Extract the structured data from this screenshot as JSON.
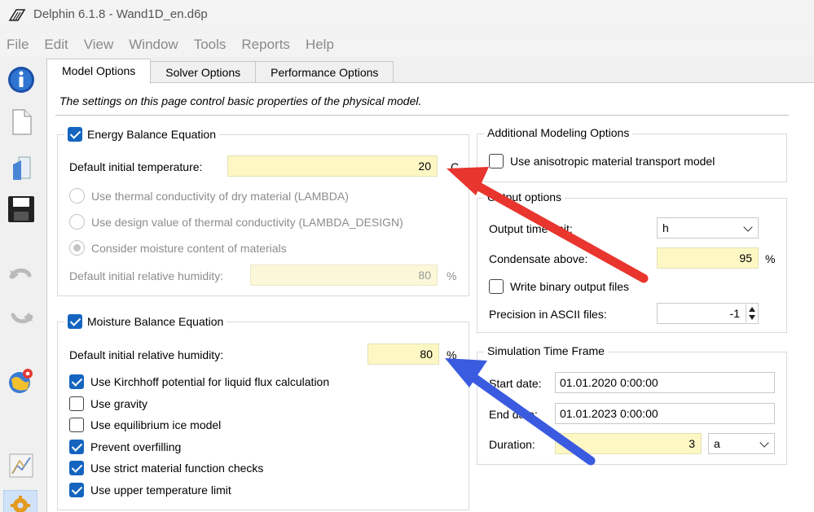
{
  "window": {
    "title": "Delphin 6.1.8 - Wand1D_en.d6p"
  },
  "menu": [
    "File",
    "Edit",
    "View",
    "Window",
    "Tools",
    "Reports",
    "Help"
  ],
  "toolbar": [
    {
      "icon": "info-icon"
    },
    {
      "icon": "new-file-icon"
    },
    {
      "icon": "open-file-icon"
    },
    {
      "icon": "save-icon"
    },
    {
      "icon": "undo-icon"
    },
    {
      "icon": "redo-icon"
    },
    {
      "icon": "globe-location-icon"
    },
    {
      "icon": "chart-icon"
    },
    {
      "icon": "settings-gear-icon"
    }
  ],
  "tabs": [
    "Model Options",
    "Solver Options",
    "Performance Options"
  ],
  "active_tab": "Model Options",
  "intro": "The settings on this page control basic properties of the physical model.",
  "energy": {
    "title": "Energy Balance Equation",
    "checked": true,
    "temp_label": "Default initial temperature:",
    "temp_value": "20",
    "temp_unit": "C",
    "radio1": "Use thermal conductivity of dry material (LAMBDA)",
    "radio2": "Use design value of thermal conductivity (LAMBDA_DESIGN)",
    "radio3": "Consider moisture content of materials",
    "rh_label": "Default initial relative humidity:",
    "rh_value": "80",
    "rh_unit": "%"
  },
  "moisture": {
    "title": "Moisture Balance Equation",
    "checked": true,
    "rh_label": "Default initial relative humidity:",
    "rh_value": "80",
    "rh_unit": "%",
    "options": [
      {
        "label": "Use Kirchhoff potential for liquid flux calculation",
        "checked": true
      },
      {
        "label": "Use gravity",
        "checked": false
      },
      {
        "label": "Use equilibrium ice model",
        "checked": false
      },
      {
        "label": "Prevent overfilling",
        "checked": true
      },
      {
        "label": "Use strict material function checks",
        "checked": true
      },
      {
        "label": "Use upper temperature limit",
        "checked": true
      }
    ]
  },
  "additional": {
    "title": "Additional Modeling Options",
    "anisotropic_label": "Use anisotropic material transport model",
    "anisotropic_checked": false
  },
  "output": {
    "title": "Output options",
    "time_unit_label": "Output time unit:",
    "time_unit_value": "h",
    "condensate_label": "Condensate above:",
    "condensate_value": "95",
    "condensate_unit": "%",
    "binary_label": "Write binary output files",
    "binary_checked": false,
    "precision_label": "Precision in ASCII files:",
    "precision_value": "-1"
  },
  "timeframe": {
    "title": "Simulation Time Frame",
    "start_label": "Start date:",
    "start_value": "01.01.2020  0:00:00",
    "end_label": "End date:",
    "end_value": "01.01.2023  0:00:00",
    "duration_label": "Duration:",
    "duration_value": "3",
    "duration_unit": "a"
  },
  "annotations": {
    "red_arrow_color": "#e8352e",
    "blue_arrow_color": "#3a5be0"
  }
}
